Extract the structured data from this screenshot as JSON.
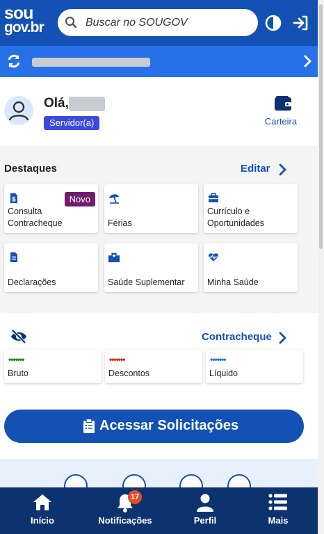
{
  "header": {
    "logo_line1": "sou",
    "logo_line2": "gov.br",
    "search_placeholder": "Buscar no SOUGOV"
  },
  "profile": {
    "greeting": "Olá,",
    "role_badge": "Servidor(a)",
    "wallet_label": "Carteira"
  },
  "destaques": {
    "title": "Destaques",
    "edit_label": "Editar",
    "cards": [
      {
        "label": "Consulta Contracheque",
        "badge": "Novo",
        "icon": "dollar-doc-icon"
      },
      {
        "label": "Férias",
        "icon": "beach-umbrella-icon"
      },
      {
        "label": "Currículo e Oportunidades",
        "icon": "briefcase-icon"
      },
      {
        "label": "Declarações",
        "icon": "document-icon"
      },
      {
        "label": "Saúde Suplementar",
        "icon": "hospital-icon"
      },
      {
        "label": "Minha Saúde",
        "icon": "heart-pulse-icon"
      }
    ]
  },
  "contracheque": {
    "link_label": "Contracheque",
    "cards": [
      {
        "label": "Bruto",
        "dots": "•••••••",
        "color": "#168821"
      },
      {
        "label": "Descontos",
        "dots": "•••••••",
        "color": "#e52207"
      },
      {
        "label": "Líquido",
        "dots": "•••••••",
        "color": "#2670e8"
      }
    ],
    "cta_label": "Acessar Solicitações"
  },
  "bottom_nav": {
    "items": [
      {
        "label": "Início",
        "icon": "home-icon"
      },
      {
        "label": "Notificações",
        "icon": "bell-icon",
        "badge": "17"
      },
      {
        "label": "Perfil",
        "icon": "person-icon"
      },
      {
        "label": "Mais",
        "icon": "menu-list-icon"
      }
    ]
  },
  "colors": {
    "primary": "#1351b4",
    "banner": "#2670e8",
    "nav": "#0c326f",
    "novo": "#6f1d6e",
    "badge": "#3b49df"
  }
}
